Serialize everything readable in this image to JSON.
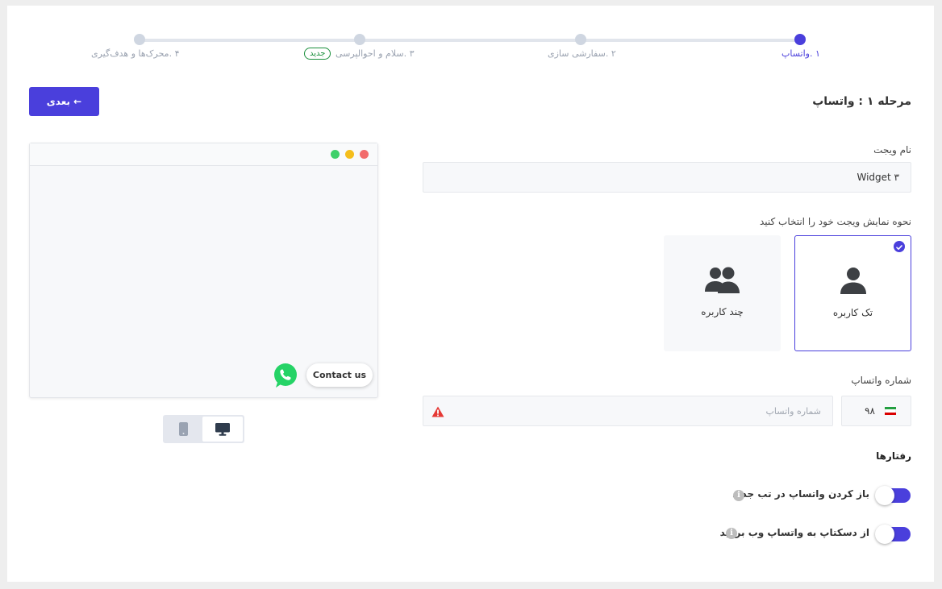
{
  "stepper": {
    "steps": [
      {
        "label": "۱ .واتساپ",
        "active": true
      },
      {
        "label": "۲ .سفارشی سازی",
        "active": false
      },
      {
        "label": "۳ .سلام و احوالپرسی",
        "active": false,
        "badge": "جدید"
      },
      {
        "label": "۴ .محرک‌ها و هدف‌گیری",
        "active": false
      }
    ]
  },
  "header": {
    "title": "مرحله ۱ : واتساپ",
    "next_label": "بعدی ←"
  },
  "form": {
    "widget_name_label": "نام ویجت",
    "widget_name_value": "Widget ۳",
    "display_mode_label": "نحوه نمایش ویجت خود را انتخاب کنید",
    "modes": [
      {
        "label": "تک کاربره",
        "icon": "single-user-icon",
        "selected": true
      },
      {
        "label": "چند کاربره",
        "icon": "multi-user-icon",
        "selected": false
      }
    ],
    "phone_label": "شماره واتساپ",
    "phone_placeholder": "شماره واتساپ",
    "phone_value": "",
    "country_code": "۹۸",
    "country_flag": "iran-flag-icon"
  },
  "behaviors": {
    "title": "رفتارها",
    "items": [
      {
        "label": "باز کردن واتساپ در تب جدید",
        "enabled": true
      },
      {
        "label": "از دسکتاپ به واتساپ وب بروید",
        "enabled": true
      }
    ]
  },
  "preview": {
    "contact_label": "Contact us",
    "devices": [
      "desktop-icon",
      "mobile-icon"
    ],
    "selected_device": "desktop"
  },
  "colors": {
    "accent": "#4a3fdc",
    "whatsapp": "#25d366",
    "badge": "#1a8f3c",
    "warning": "#e53935"
  }
}
